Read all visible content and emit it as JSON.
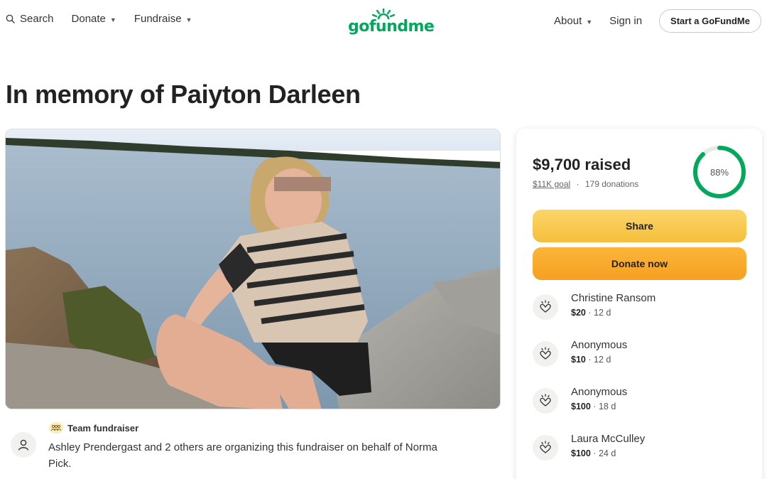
{
  "header": {
    "search_label": "Search",
    "donate_label": "Donate",
    "fundraise_label": "Fundraise",
    "logo_text": "gofundme",
    "about_label": "About",
    "signin_label": "Sign in",
    "start_label": "Start a GoFundMe"
  },
  "page": {
    "title": "In memory of Paiyton Darleen"
  },
  "organizer": {
    "badge": "Team fundraiser",
    "text": "Ashley Prendergast and 2 others are organizing this fundraiser on behalf of Norma Pick."
  },
  "summary": {
    "raised": "$9,700 raised",
    "goal": "$11K goal",
    "separator": "·",
    "donations": "179 donations",
    "percent_label": "88%",
    "percent": 0.88
  },
  "actions": {
    "share": "Share",
    "donate": "Donate now"
  },
  "donations": [
    {
      "name": "Christine Ransom",
      "amount": "$20",
      "age": "12 d"
    },
    {
      "name": "Anonymous",
      "amount": "$10",
      "age": "12 d"
    },
    {
      "name": "Anonymous",
      "amount": "$100",
      "age": "18 d"
    },
    {
      "name": "Laura McCulley",
      "amount": "$100",
      "age": "24 d"
    }
  ],
  "colors": {
    "brand_green": "#02a95c",
    "share_button": "#f5bf3c",
    "donate_button": "#f5a021"
  }
}
